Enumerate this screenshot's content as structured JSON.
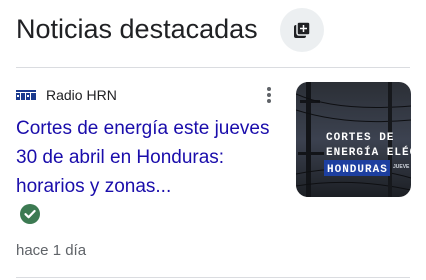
{
  "section": {
    "title": "Noticias destacadas",
    "action_icon": "add-to-library-icon"
  },
  "article": {
    "source": "Radio HRN",
    "source_logo_icon": "radio-hrn-logo",
    "headline": "Cortes de energía este jueves 30 de abril en Honduras: horarios y zonas...",
    "verified_icon": "verified-check-icon",
    "time": "hace 1 día",
    "more_icon": "more-vert-icon",
    "thumbnail": {
      "line1": "CORTES DE",
      "line2": "ENERGÍA ELÉCT",
      "banner": "HONDURAS",
      "side_text": "JUEVE"
    }
  },
  "colors": {
    "headline": "#1a0dab",
    "verified": "#3c7a52",
    "header_button_bg": "#eceff1"
  }
}
